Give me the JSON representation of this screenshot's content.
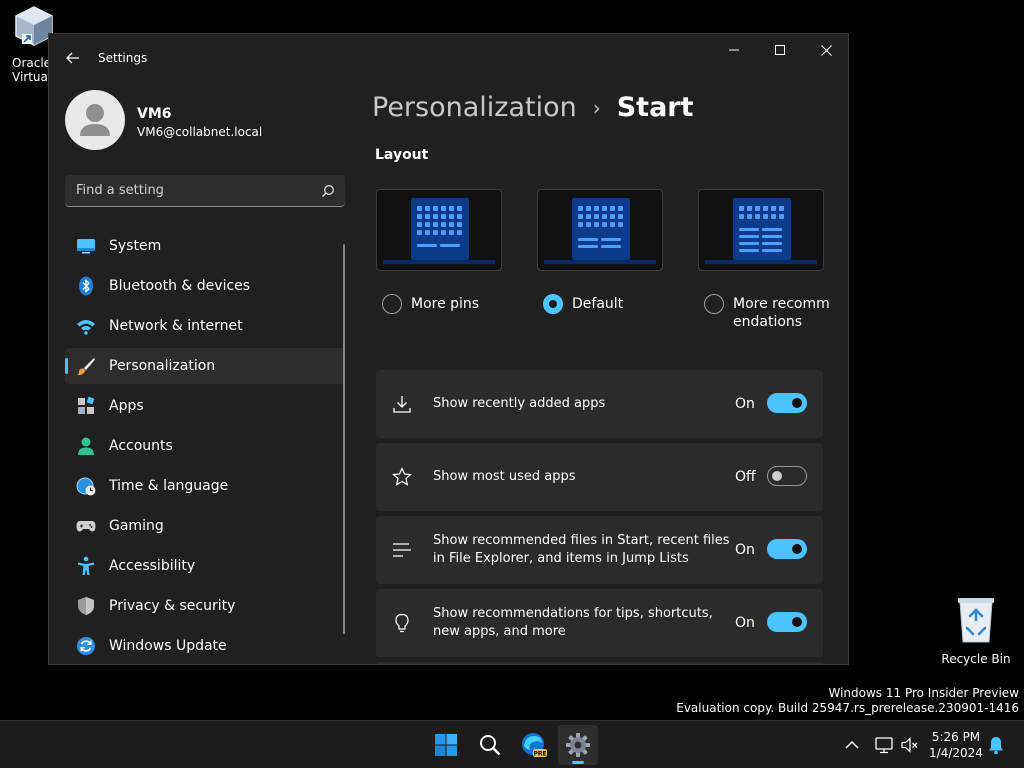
{
  "desktop": {
    "vbox_label": "Oracle\nVirtualBox",
    "vbox_label_visible": "Oracle Virtuall",
    "recycle_label": "Recycle Bin"
  },
  "window": {
    "app_title": "Settings",
    "back_icon": "arrow-left-icon",
    "controls": [
      "minimize-icon",
      "maximize-icon",
      "close-icon"
    ]
  },
  "profile": {
    "name": "VM6",
    "email": "VM6@collabnet.local"
  },
  "search": {
    "placeholder": "Find a setting",
    "value": ""
  },
  "nav": {
    "items": [
      {
        "label": "System",
        "icon": "system-icon",
        "active": false
      },
      {
        "label": "Bluetooth & devices",
        "icon": "bluetooth-icon",
        "active": false
      },
      {
        "label": "Network & internet",
        "icon": "wifi-icon",
        "active": false
      },
      {
        "label": "Personalization",
        "icon": "brush-icon",
        "active": true
      },
      {
        "label": "Apps",
        "icon": "apps-icon",
        "active": false
      },
      {
        "label": "Accounts",
        "icon": "person-icon",
        "active": false
      },
      {
        "label": "Time & language",
        "icon": "globe-clock-icon",
        "active": false
      },
      {
        "label": "Gaming",
        "icon": "gamepad-icon",
        "active": false
      },
      {
        "label": "Accessibility",
        "icon": "accessibility-icon",
        "active": false
      },
      {
        "label": "Privacy & security",
        "icon": "shield-icon",
        "active": false
      },
      {
        "label": "Windows Update",
        "icon": "refresh-icon",
        "active": false
      }
    ]
  },
  "content": {
    "breadcrumb_parent": "Personalization",
    "breadcrumb_sep": "›",
    "breadcrumb_current": "Start",
    "layout_title": "Layout",
    "layout_options": [
      {
        "label": "More pins",
        "selected": false
      },
      {
        "label": "Default",
        "selected": true
      },
      {
        "label": "More recommendations",
        "selected": false
      }
    ],
    "rows": [
      {
        "label": "Show recently added apps",
        "state": "On",
        "icon": "download-icon"
      },
      {
        "label": "Show most used apps",
        "state": "Off",
        "icon": "star-icon"
      },
      {
        "label": "Show recommended files in Start, recent files in File Explorer, and items in Jump Lists",
        "state": "On",
        "icon": "list-icon"
      },
      {
        "label": "Show recommendations for tips, shortcuts, new apps, and more",
        "state": "On",
        "icon": "lightbulb-icon"
      }
    ]
  },
  "watermark": {
    "line1": "Windows 11 Pro Insider Preview",
    "line2": "Evaluation copy. Build 25947.rs_prerelease.230901-1416"
  },
  "taskbar": {
    "time": "5:26 PM",
    "date": "1/4/2024",
    "edge_badge": "PRE"
  },
  "colors": {
    "accent": "#4cc2ff",
    "window_bg": "#202020",
    "card_bg": "#2b2b2b"
  }
}
